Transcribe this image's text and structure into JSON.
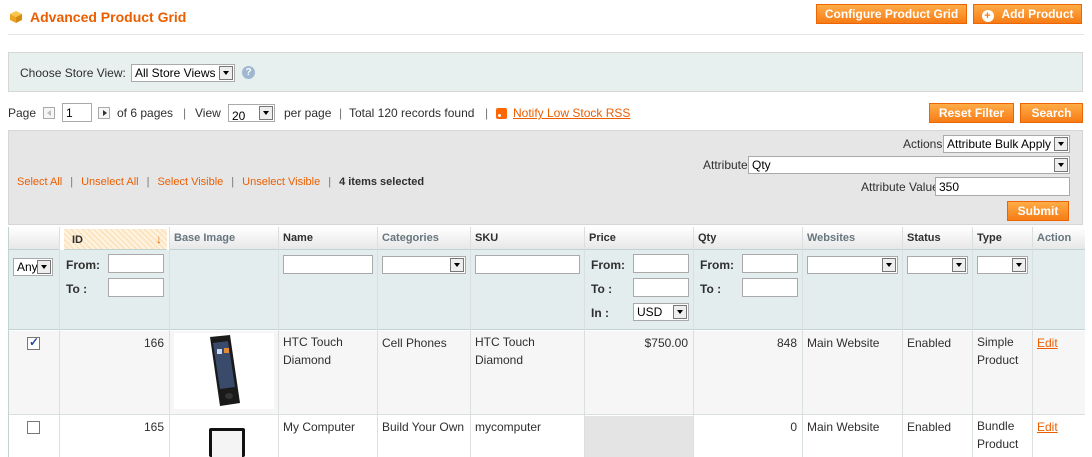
{
  "header": {
    "title": "Advanced Product Grid",
    "configure_label": "Configure Product Grid",
    "add_label": "Add Product"
  },
  "store_view": {
    "label": "Choose Store View:",
    "selected": "All Store Views"
  },
  "pager": {
    "page_label": "Page",
    "page_value": "1",
    "of_pages": "of 6 pages",
    "view_label": "View",
    "per_page_value": "20",
    "per_page_label": "per page",
    "total": "Total 120 records found",
    "rss_label": "Notify Low Stock RSS",
    "sep": "|"
  },
  "actions": {
    "reset_label": "Reset Filter",
    "search_label": "Search"
  },
  "massaction": {
    "select_all": "Select All",
    "unselect_all": "Unselect All",
    "select_visible": "Select Visible",
    "unselect_visible": "Unselect Visible",
    "sep": "|",
    "count": "4 items selected",
    "actions_label": "Actions",
    "actions_value": "Attribute Bulk Apply",
    "attribute_label": "Attribute",
    "attribute_value": "Qty",
    "attr_value_label": "Attribute Value",
    "attr_value": "350",
    "submit_label": "Submit"
  },
  "columns": {
    "id": "ID",
    "base_image": "Base Image",
    "name": "Name",
    "categories": "Categories",
    "sku": "SKU",
    "price": "Price",
    "qty": "Qty",
    "websites": "Websites",
    "status": "Status",
    "type": "Type",
    "action": "Action"
  },
  "filters": {
    "any": "Any",
    "from": "From:",
    "to": "To :",
    "in": "In :",
    "currency": "USD"
  },
  "rows": [
    {
      "checked": true,
      "id": "166",
      "name": "HTC Touch Diamond",
      "categories": "Cell Phones",
      "sku": "HTC Touch Diamond",
      "price": "$750.00",
      "qty": "848",
      "websites": "Main Website",
      "status": "Enabled",
      "type": "Simple Product",
      "action": "Edit"
    },
    {
      "checked": false,
      "id": "165",
      "name": "My Computer",
      "categories": "Build Your Own",
      "sku": "mycomputer",
      "price": "",
      "qty": "0",
      "websites": "Main Website",
      "status": "Enabled",
      "type": "Bundle Product",
      "action": "Edit"
    }
  ],
  "colors": {
    "accent": "#eb5e00",
    "button": "#f77c16",
    "filter_bg": "#e3eded"
  }
}
